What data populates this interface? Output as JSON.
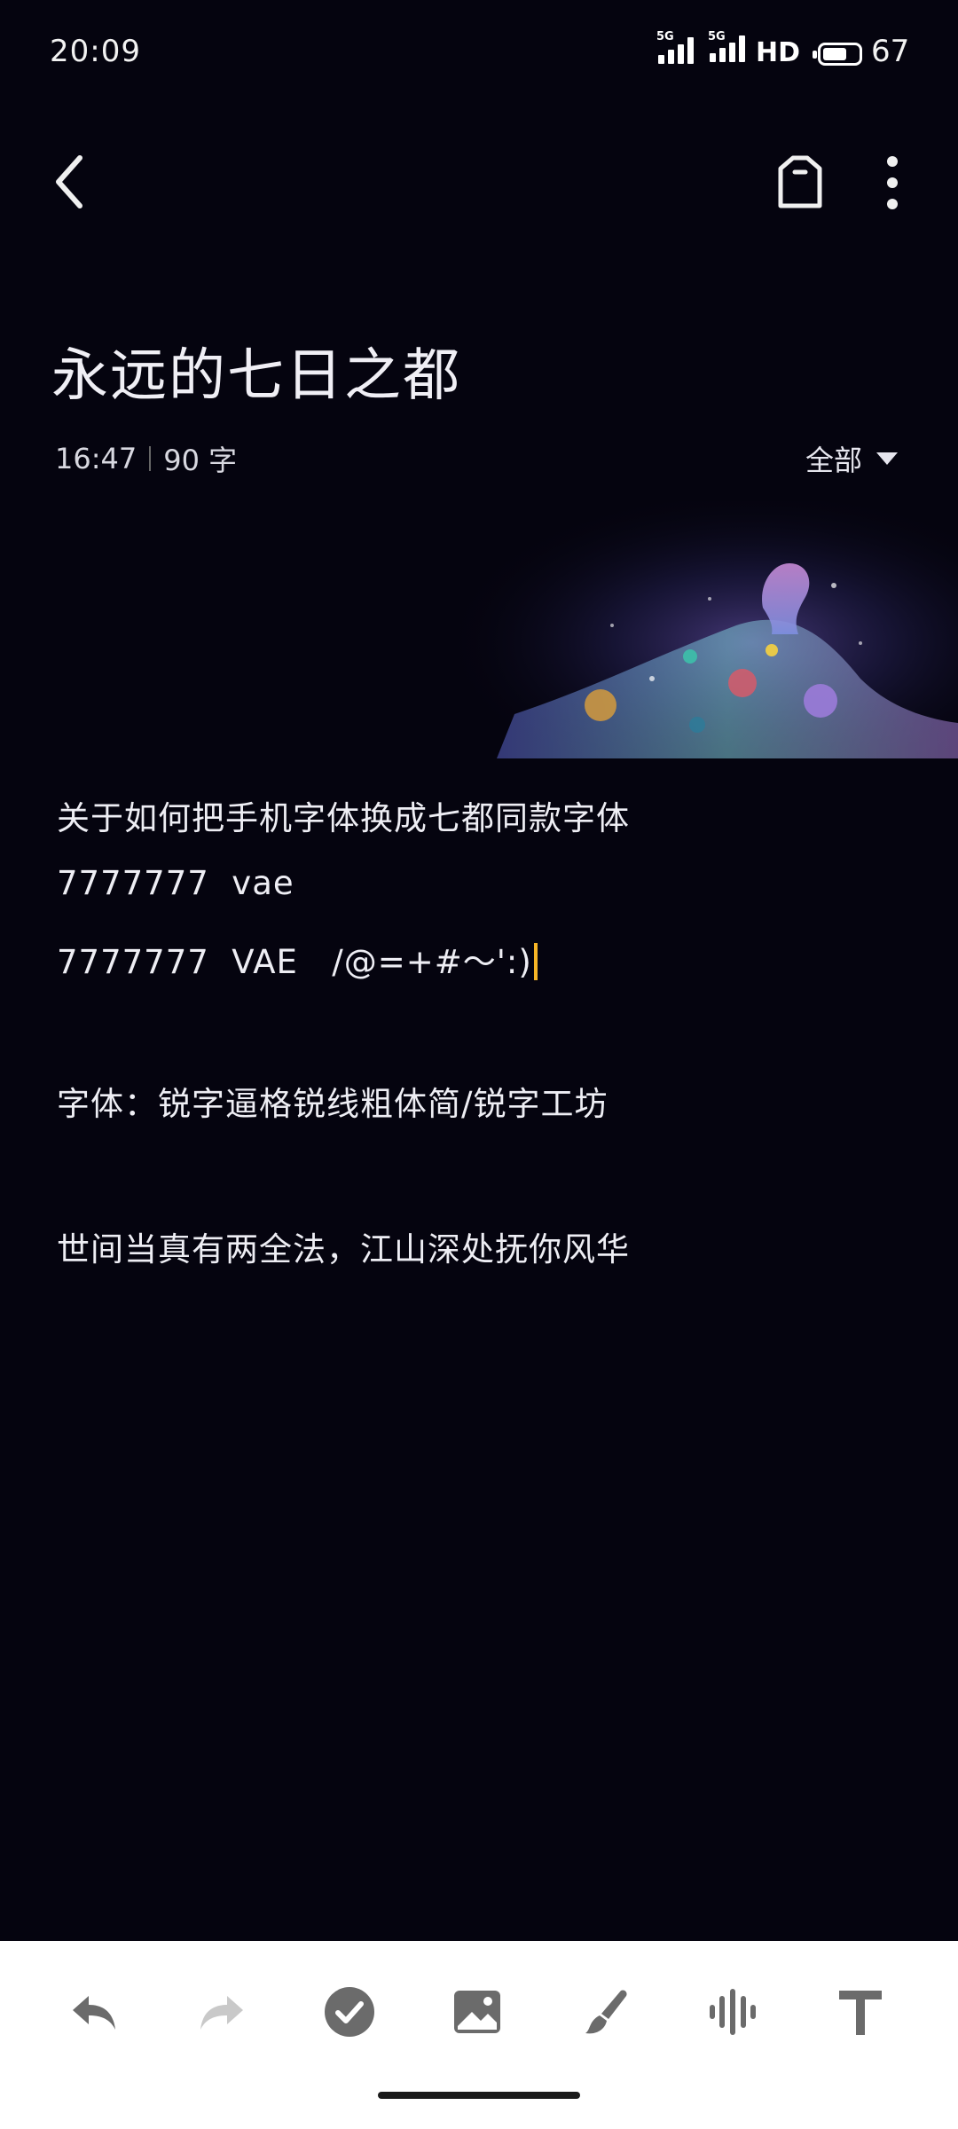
{
  "status_bar": {
    "time": "20:09",
    "signal_1_label": "5G",
    "signal_2_label": "5G",
    "hd_label": "HD",
    "battery_level": "67",
    "battery_fraction": 0.67
  },
  "header": {
    "back_icon": "chevron-left-icon",
    "tag_icon": "tag-icon",
    "more_icon": "more-vertical-icon"
  },
  "note": {
    "title": "永远的七日之都",
    "time": "16:47",
    "word_count": "90 字",
    "folder": "全部",
    "lines": [
      "关于如何把手机字体换成七都同款字体",
      "7777777  vae",
      "7777777  VAE   /@=+#～':)",
      "字体：锐字逼格锐线粗体简/锐字工坊",
      "世间当真有两全法，江山深处抚你风华"
    ]
  },
  "toolbar": {
    "items": [
      {
        "name": "undo-icon",
        "color": "#6b6b6b"
      },
      {
        "name": "redo-icon",
        "color": "#c9c9c9"
      },
      {
        "name": "checklist-icon",
        "color": "#6b6b6b"
      },
      {
        "name": "image-icon",
        "color": "#6b6b6b"
      },
      {
        "name": "brush-icon",
        "color": "#6b6b6b"
      },
      {
        "name": "voice-icon",
        "color": "#6b6b6b"
      },
      {
        "name": "text-format-icon",
        "color": "#6b6b6b"
      }
    ]
  },
  "colors": {
    "background": "#05040f",
    "cursor": "#f7b526",
    "toolbar_bg": "#ffffff"
  }
}
